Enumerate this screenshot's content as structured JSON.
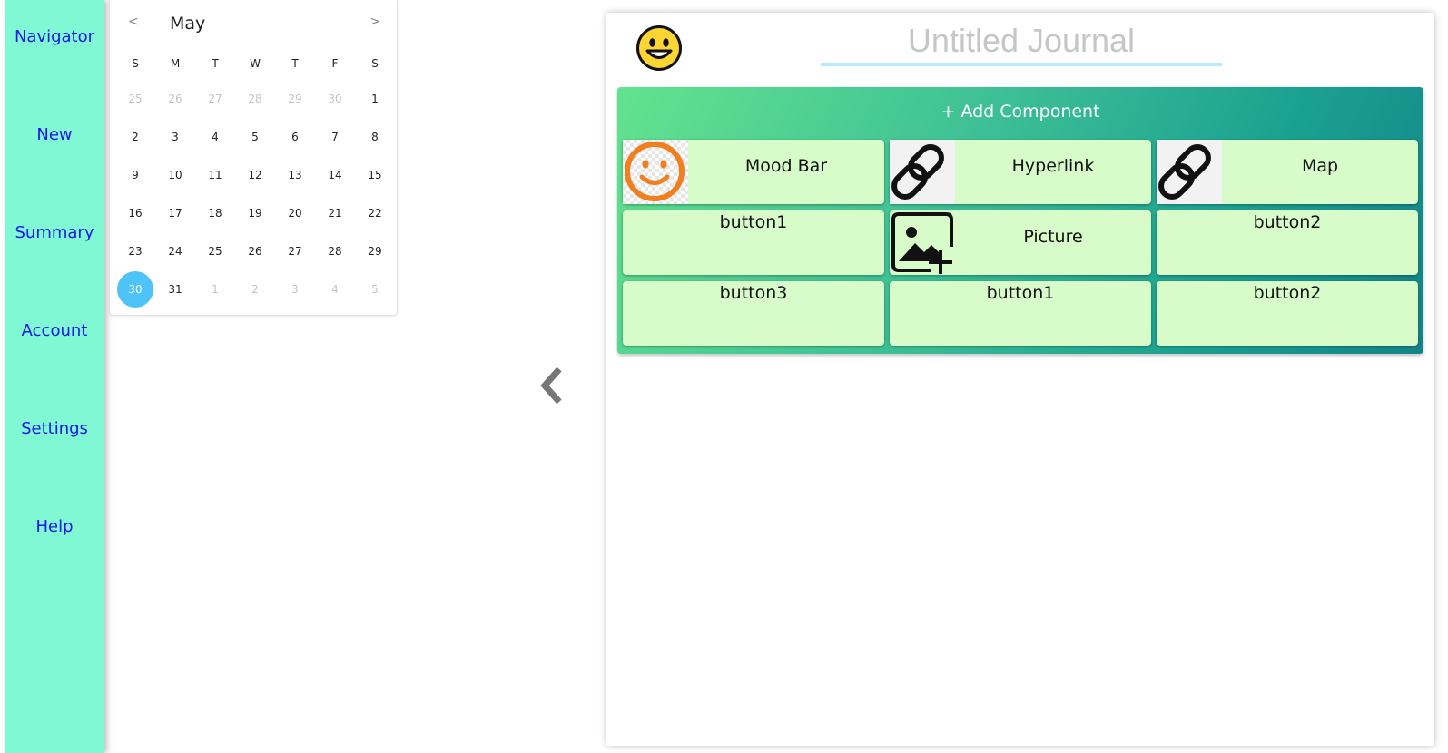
{
  "sidebar": {
    "items": [
      {
        "label": "Navigator"
      },
      {
        "label": "New"
      },
      {
        "label": "Summary"
      },
      {
        "label": "Account"
      },
      {
        "label": "Settings"
      },
      {
        "label": "Help"
      }
    ]
  },
  "calendar": {
    "prev": "<",
    "next": ">",
    "month": "May",
    "weekdays": [
      "S",
      "M",
      "T",
      "W",
      "T",
      "F",
      "S"
    ],
    "weeks": [
      [
        "25",
        "26",
        "27",
        "28",
        "29",
        "30",
        "1"
      ],
      [
        "2",
        "3",
        "4",
        "5",
        "6",
        "7",
        "8"
      ],
      [
        "9",
        "10",
        "11",
        "12",
        "13",
        "14",
        "15"
      ],
      [
        "16",
        "17",
        "18",
        "19",
        "20",
        "21",
        "22"
      ],
      [
        "23",
        "24",
        "25",
        "26",
        "27",
        "28",
        "29"
      ],
      [
        "30",
        "31",
        "1",
        "2",
        "3",
        "4",
        "5"
      ]
    ],
    "selected_day": "30"
  },
  "collapse_icon": "chevron-left-icon",
  "journal": {
    "title_placeholder": "Untitled Journal",
    "mood_icon": "smiley-face-icon",
    "add_component": "+ Add Component",
    "tiles": [
      {
        "label": "Mood Bar",
        "icon": "mood-smiley-icon"
      },
      {
        "label": "Hyperlink",
        "icon": "link-icon"
      },
      {
        "label": "Map",
        "icon": "link-icon"
      },
      {
        "label": "button1",
        "icon": ""
      },
      {
        "label": "Picture",
        "icon": "add-picture-icon"
      },
      {
        "label": "button2",
        "icon": ""
      },
      {
        "label": "button3",
        "icon": ""
      },
      {
        "label": "button1",
        "icon": ""
      },
      {
        "label": "button2",
        "icon": ""
      }
    ]
  },
  "colors": {
    "sidebar_bg": "#7ff8d3",
    "nav_text": "#1616e8",
    "selected_day": "#4ec3f7",
    "tile_bg": "#d8fcc9",
    "mood_orange": "#f07f20"
  }
}
